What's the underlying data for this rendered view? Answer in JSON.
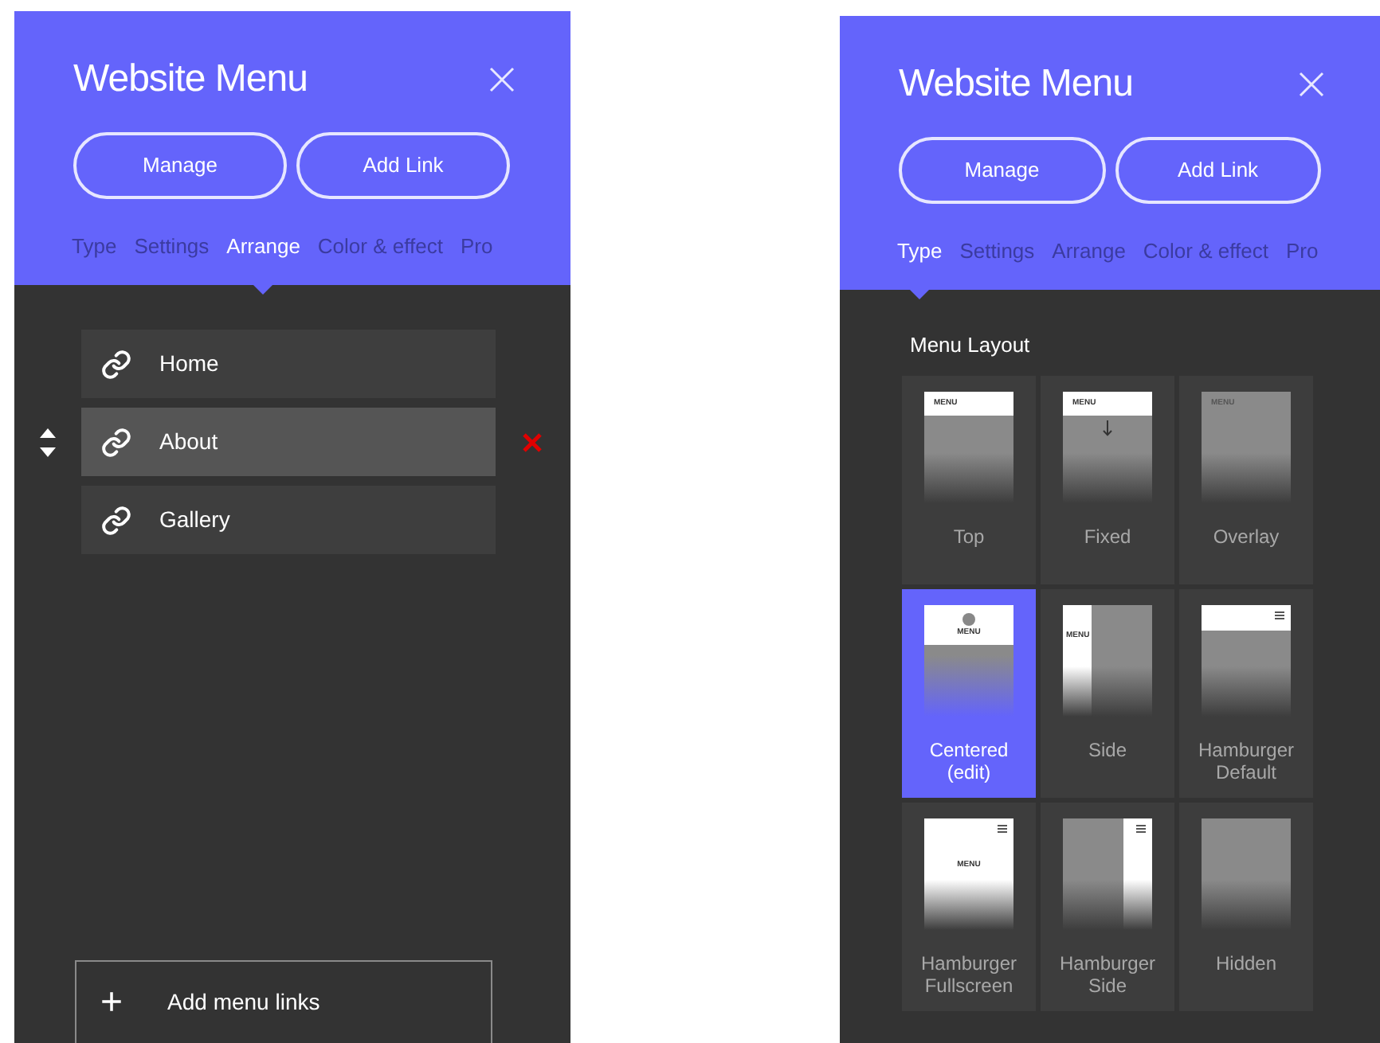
{
  "panels": [
    {
      "title": "Website Menu",
      "buttons": [
        "Manage",
        "Add Link"
      ],
      "tabs": [
        {
          "label": "Type",
          "selected": false
        },
        {
          "label": "Settings",
          "selected": false
        },
        {
          "label": "Arrange",
          "selected": true
        },
        {
          "label": "Color & effect",
          "selected": false
        },
        {
          "label": "Pro",
          "selected": false
        }
      ],
      "kind": "arrange",
      "links": [
        {
          "label": "Home",
          "selected": false
        },
        {
          "label": "About",
          "selected": true
        },
        {
          "label": "Gallery",
          "selected": false
        }
      ],
      "add_button": {
        "icon": "+",
        "label": "Add menu links"
      }
    },
    {
      "title": "Website Menu",
      "buttons": [
        "Manage",
        "Add Link"
      ],
      "tabs": [
        {
          "label": "Type",
          "selected": true
        },
        {
          "label": "Settings",
          "selected": false
        },
        {
          "label": "Arrange",
          "selected": false
        },
        {
          "label": "Color & effect",
          "selected": false
        },
        {
          "label": "Pro",
          "selected": false
        }
      ],
      "kind": "type",
      "section_title": "Menu Layout",
      "layouts": [
        {
          "label": "Top",
          "kind": "top",
          "preview_text": "MENU",
          "selected": false
        },
        {
          "label": "Fixed",
          "kind": "fixed",
          "preview_text": "MENU",
          "selected": false
        },
        {
          "label": "Overlay",
          "kind": "overlay",
          "preview_text": "MENU",
          "selected": false
        },
        {
          "label": "Centered (edit)",
          "kind": "centered",
          "preview_text": "MENU",
          "selected": true
        },
        {
          "label": "Side",
          "kind": "side",
          "preview_text": "MENU",
          "selected": false
        },
        {
          "label": "Hamburger Default",
          "kind": "hamburger_default",
          "selected": false
        },
        {
          "label": "Hamburger Fullscreen",
          "kind": "hamburger_fullscreen",
          "preview_text": "MENU",
          "selected": false
        },
        {
          "label": "Hamburger Side",
          "kind": "hamburger_side",
          "selected": false
        },
        {
          "label": "Hidden",
          "kind": "hidden",
          "selected": false
        }
      ]
    }
  ]
}
